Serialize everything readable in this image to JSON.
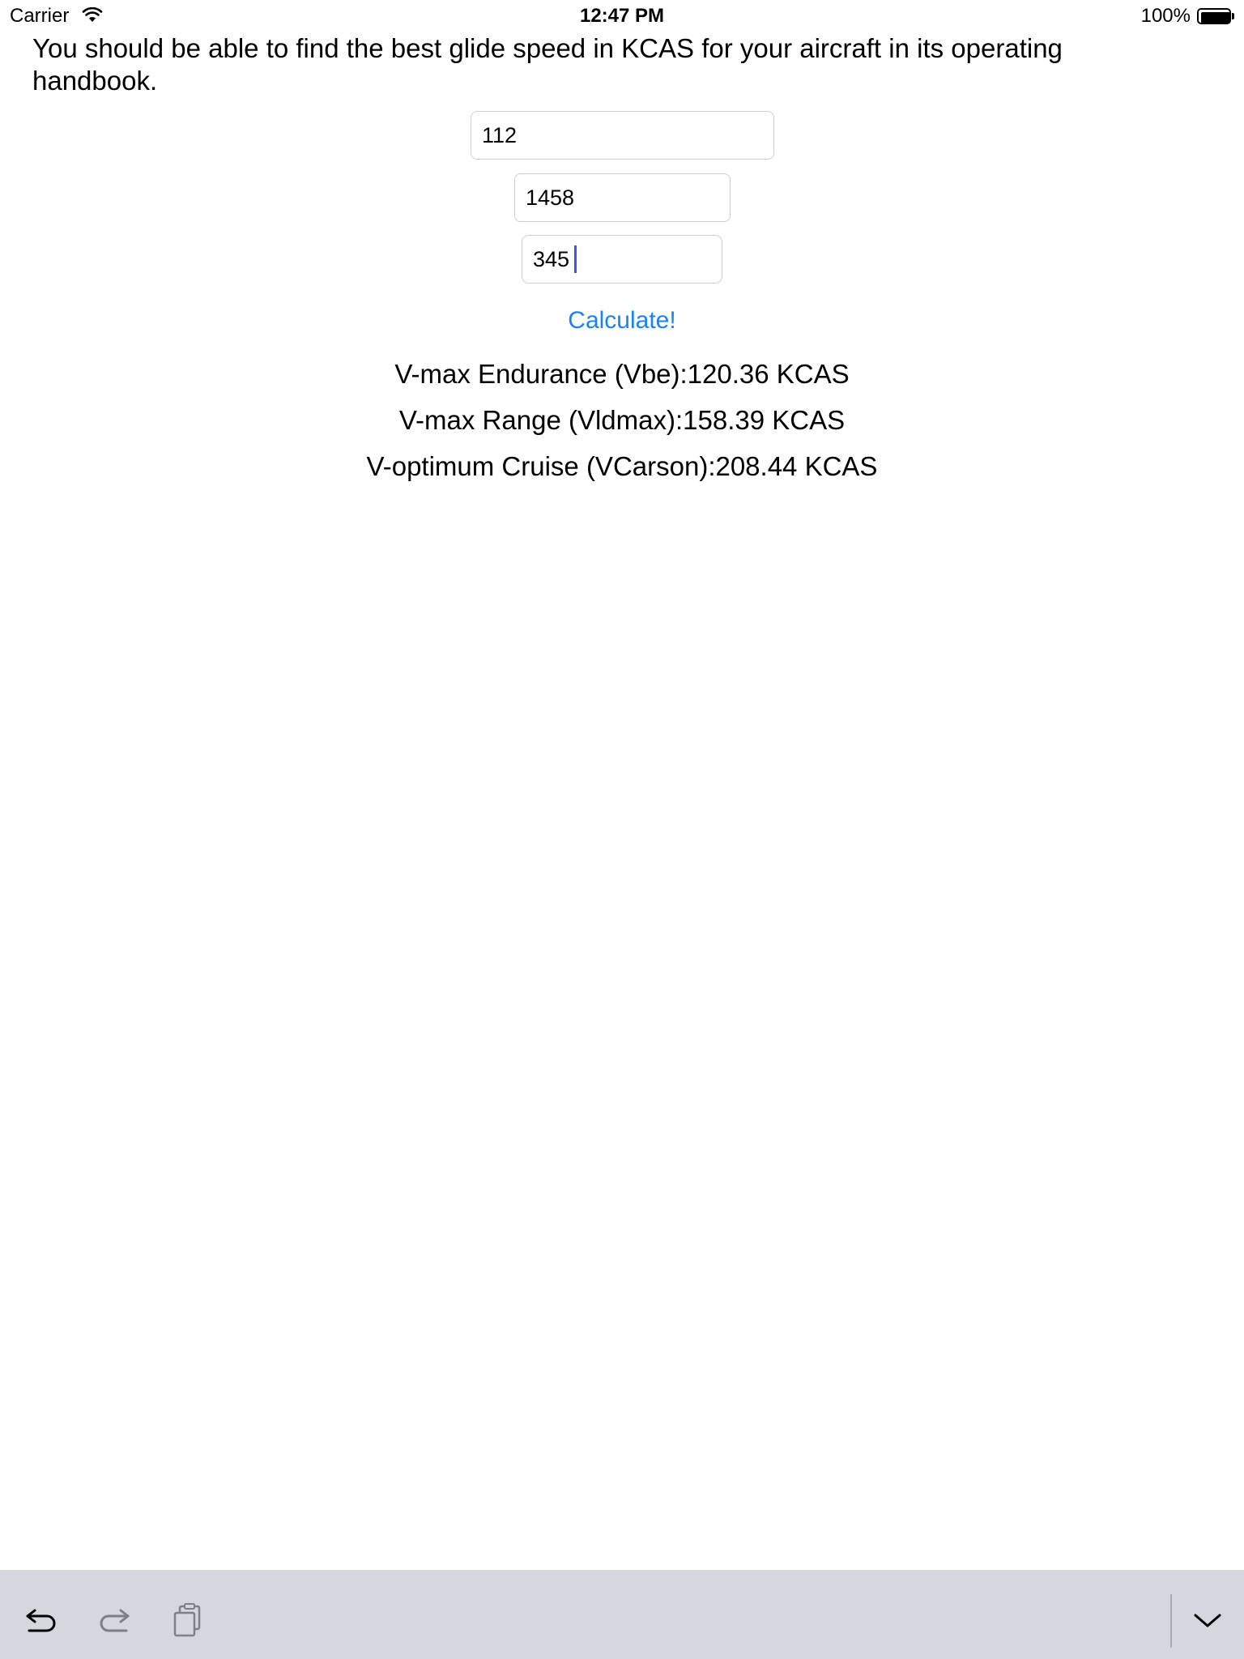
{
  "status_bar": {
    "carrier": "Carrier",
    "time": "12:47 PM",
    "battery": "100%",
    "wifi_icon": "wifi-icon",
    "battery_icon": "battery-icon"
  },
  "instruction": "You should be able to find the best glide speed in KCAS for your aircraft in its operating handbook.",
  "inputs": [
    {
      "value": "112"
    },
    {
      "value": "1458"
    },
    {
      "value": "345"
    }
  ],
  "calculate_label": "Calculate!",
  "results": [
    "V-max Endurance (Vbe):120.36 KCAS",
    "V-max Range (Vldmax):158.39 KCAS",
    "V-optimum Cruise (VCarson):208.44 KCAS"
  ],
  "shortcut_bar": {
    "icons": [
      "undo-icon",
      "redo-icon",
      "paste-icon",
      "dismiss-keyboard-icon"
    ]
  },
  "colors": {
    "accent": "#1a82f7",
    "caret": "#3b5bdb",
    "shortcut_bar_bg": "#d4d8de",
    "field_border": "#cfcfcf"
  }
}
